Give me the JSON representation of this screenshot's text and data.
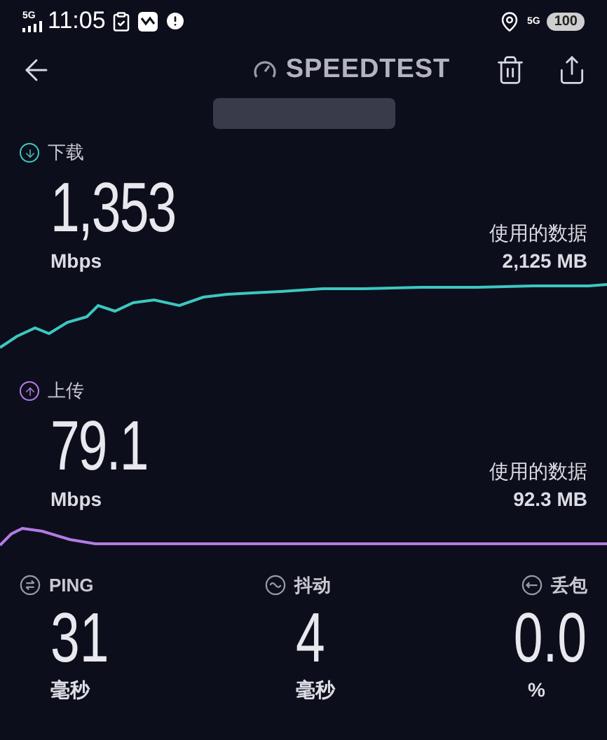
{
  "status_bar": {
    "network": "5G",
    "time": "11:05",
    "right_network": "5G",
    "battery": "100"
  },
  "header": {
    "title": "SPEEDTEST"
  },
  "download": {
    "label": "下载",
    "value": "1,353",
    "unit": "Mbps",
    "data_label": "使用的数据",
    "data_value": "2,125 MB"
  },
  "upload": {
    "label": "上传",
    "value": "79.1",
    "unit": "Mbps",
    "data_label": "使用的数据",
    "data_value": "92.3 MB"
  },
  "stats": [
    {
      "kind": "ping",
      "label": "PING",
      "value": "31",
      "unit": "毫秒"
    },
    {
      "kind": "jitter",
      "label": "抖动",
      "value": "4",
      "unit": "毫秒"
    },
    {
      "kind": "loss",
      "label": "丢包",
      "value": "0.0",
      "unit": "%"
    }
  ]
}
